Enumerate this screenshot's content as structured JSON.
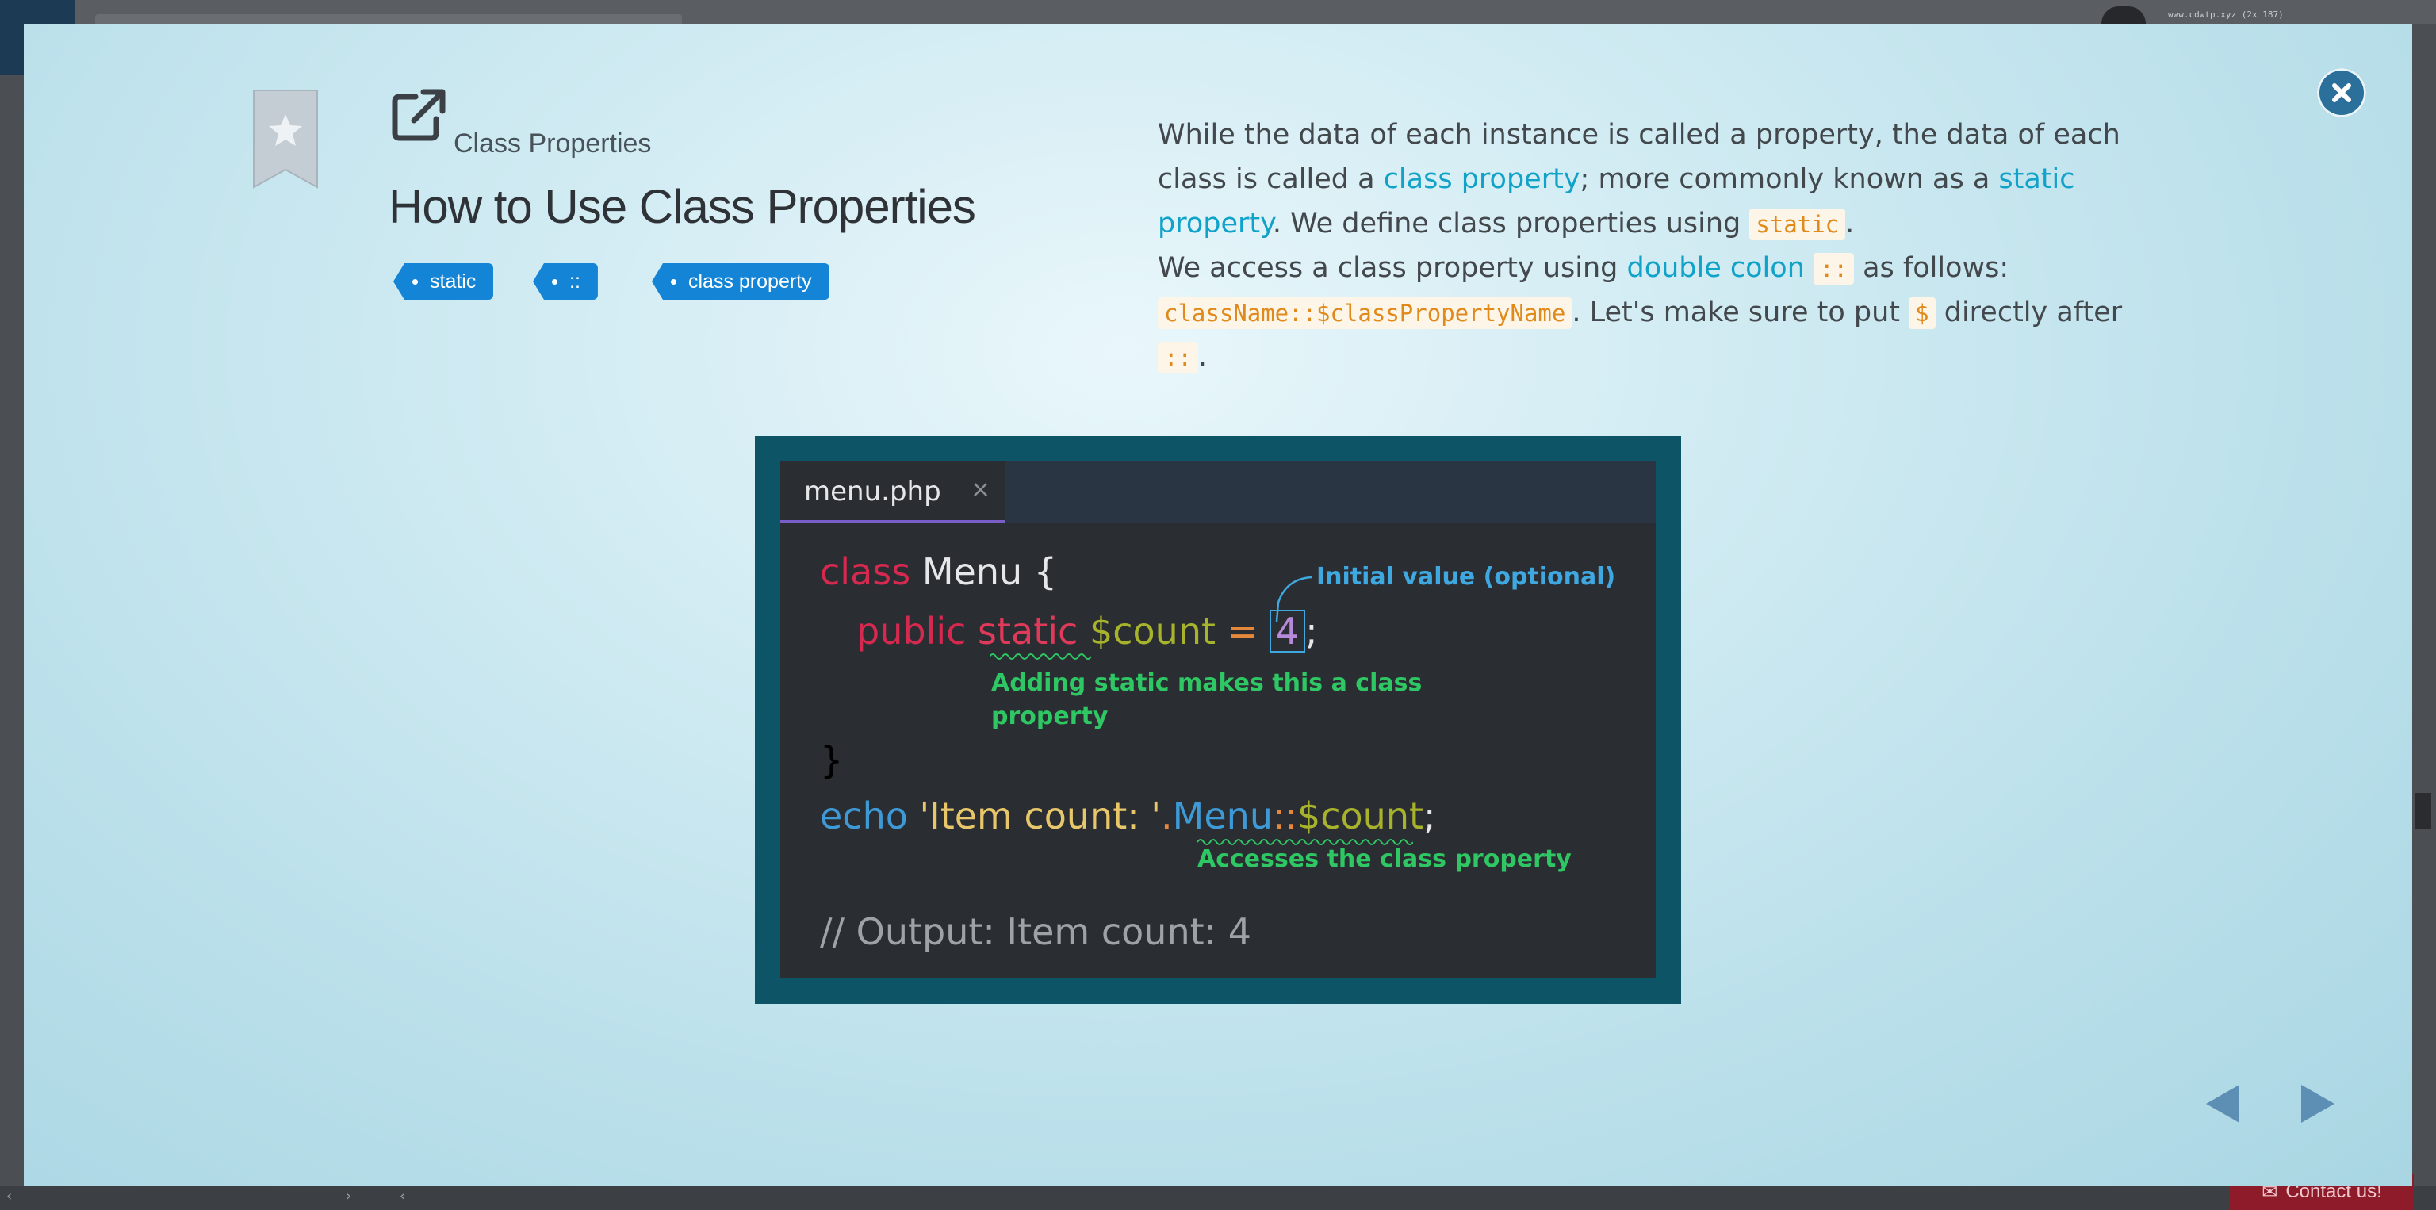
{
  "background": {
    "url_text": "www.cdwtp.xyz (2x 187)",
    "contact_label": "Contact us!"
  },
  "modal": {
    "breadcrumb": "Class Properties",
    "title": "How to Use Class Properties",
    "tags": [
      "static",
      "::",
      "class property"
    ],
    "description": {
      "p1": {
        "t1": "While the data of each instance is called a property, the data of each class is called a ",
        "link1": "class property",
        "t2": "; more commonly known as a ",
        "link2": "static property",
        "t3": ". We define class properties using ",
        "code1": "static",
        "t4": "."
      },
      "p2": {
        "t1": "We access a class property using ",
        "link1": "double colon",
        "t2": " ",
        "code1": "::",
        "t3": " as follows: ",
        "code2": "className::$classPropertyName",
        "t4": ". Let's make sure to put ",
        "code3": "$",
        "t5": " directly after ",
        "code4": "::",
        "t6": "."
      }
    },
    "code_image": {
      "tab_name": "menu.php",
      "tab_close": "×",
      "line1": {
        "kw": "class",
        "rest": " Menu {"
      },
      "line2": {
        "kw1": "public",
        "kw2": "static",
        "var": "$count",
        "eq": " = ",
        "num": "4",
        "semi": ";"
      },
      "line3": "}",
      "line4": {
        "kw": "echo",
        "str": " 'Item count: '",
        "dot": ".",
        "cls": "Menu",
        "dc": "::",
        "var": "$count",
        "semi": ";"
      },
      "line5": "// Output: Item count: 4",
      "annot_initial": "Initial value (optional)",
      "annot_static_1": "Adding static makes this a class",
      "annot_static_2": "property",
      "annot_access": "Accesses the class property"
    }
  },
  "icons": [
    "close-icon",
    "bookmark-icon",
    "external-link-icon",
    "prev-arrow-icon",
    "next-arrow-icon"
  ],
  "colors": {
    "tag_bg": "#1485d6",
    "link": "#10a2c9",
    "code_text": "#e08a1c",
    "code_frame": "#0d5566",
    "close_btn": "#2b6f9b",
    "nav_arrow": "#5d8eb4"
  }
}
